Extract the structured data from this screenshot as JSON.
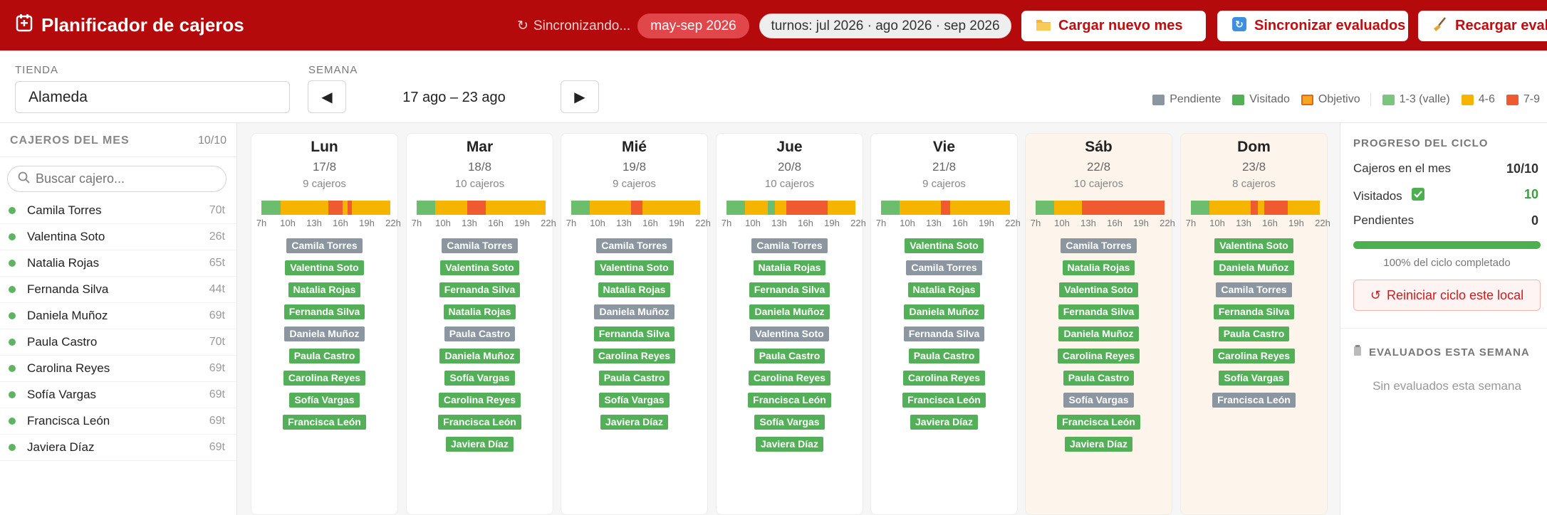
{
  "app": {
    "title": "Planificador de cajeros"
  },
  "header": {
    "sync_status": "Sincronizando...",
    "range_pill": "may-sep 2026",
    "turnos_pill": "turnos: jul 2026 · ago 2026 · sep 2026",
    "btn_cargar": "Cargar nuevo mes",
    "btn_sync": "Sincronizar evaluados",
    "btn_recargar": "Recargar evaluados"
  },
  "toolbar": {
    "tienda_label": "TIENDA",
    "tienda_value": "Alameda",
    "semana_label": "SEMANA",
    "week_range": "17 ago – 23 ago",
    "prev_symbol": "◀",
    "next_symbol": "▶"
  },
  "legend": [
    {
      "label": "Pendiente",
      "color": "#8b96a0"
    },
    {
      "label": "Visitado",
      "color": "#54b058"
    },
    {
      "label": "Objetivo",
      "color": "#f5a623"
    },
    {
      "label": "1-3 (valle)",
      "color": "#7cc57f"
    },
    {
      "label": "4-6",
      "color": "#f4b400"
    },
    {
      "label": "7-9",
      "color": "#f05a30"
    }
  ],
  "sidebar": {
    "title": "CAJEROS DEL MES",
    "count": "10/10",
    "search_placeholder": "Buscar cajero...",
    "cashiers": [
      {
        "name": "Camila Torres",
        "turns": "70t"
      },
      {
        "name": "Valentina Soto",
        "turns": "26t"
      },
      {
        "name": "Natalia Rojas",
        "turns": "65t"
      },
      {
        "name": "Fernanda Silva",
        "turns": "44t"
      },
      {
        "name": "Daniela Muñoz",
        "turns": "69t"
      },
      {
        "name": "Paula Castro",
        "turns": "70t"
      },
      {
        "name": "Carolina Reyes",
        "turns": "69t"
      },
      {
        "name": "Sofía Vargas",
        "turns": "69t"
      },
      {
        "name": "Francisca León",
        "turns": "69t"
      },
      {
        "name": "Javiera Díaz",
        "turns": "69t"
      }
    ]
  },
  "tick_labels": [
    "7h",
    "10h",
    "13h",
    "16h",
    "19h",
    "22h"
  ],
  "intensity_colors": {
    "g": "#6cbd6e",
    "y": "#f4b400",
    "r": "#f05a30"
  },
  "days": [
    {
      "name": "Lun",
      "date": "17/8",
      "count": "9 cajeros",
      "weekend": false,
      "bar": [
        [
          "g",
          2
        ],
        [
          "y",
          5
        ],
        [
          "r",
          1.5
        ],
        [
          "y",
          0.5
        ],
        [
          "r",
          0.5
        ],
        [
          "y",
          4
        ]
      ],
      "chips": [
        [
          "Camila Torres",
          "p"
        ],
        [
          "Valentina Soto",
          "v"
        ],
        [
          "Natalia Rojas",
          "v"
        ],
        [
          "Fernanda Silva",
          "v"
        ],
        [
          "Daniela Muñoz",
          "p"
        ],
        [
          "Paula Castro",
          "v"
        ],
        [
          "Carolina Reyes",
          "v"
        ],
        [
          "Sofía Vargas",
          "v"
        ],
        [
          "Francisca León",
          "v"
        ]
      ]
    },
    {
      "name": "Mar",
      "date": "18/8",
      "count": "10 cajeros",
      "weekend": false,
      "bar": [
        [
          "g",
          2
        ],
        [
          "y",
          3.5
        ],
        [
          "r",
          2
        ],
        [
          "y",
          6.5
        ]
      ],
      "chips": [
        [
          "Camila Torres",
          "p"
        ],
        [
          "Valentina Soto",
          "v"
        ],
        [
          "Fernanda Silva",
          "v"
        ],
        [
          "Natalia Rojas",
          "v"
        ],
        [
          "Paula Castro",
          "p"
        ],
        [
          "Daniela Muñoz",
          "v"
        ],
        [
          "Sofía Vargas",
          "v"
        ],
        [
          "Carolina Reyes",
          "v"
        ],
        [
          "Francisca León",
          "v"
        ],
        [
          "Javiera Díaz",
          "v"
        ]
      ]
    },
    {
      "name": "Mié",
      "date": "19/8",
      "count": "9 cajeros",
      "weekend": false,
      "bar": [
        [
          "g",
          2
        ],
        [
          "y",
          4.5
        ],
        [
          "r",
          1.2
        ],
        [
          "y",
          6.3
        ]
      ],
      "chips": [
        [
          "Camila Torres",
          "p"
        ],
        [
          "Valentina Soto",
          "v"
        ],
        [
          "Natalia Rojas",
          "v"
        ],
        [
          "Daniela Muñoz",
          "p"
        ],
        [
          "Fernanda Silva",
          "v"
        ],
        [
          "Carolina Reyes",
          "v"
        ],
        [
          "Paula Castro",
          "v"
        ],
        [
          "Sofía Vargas",
          "v"
        ],
        [
          "Javiera Díaz",
          "v"
        ]
      ]
    },
    {
      "name": "Jue",
      "date": "20/8",
      "count": "10 cajeros",
      "weekend": false,
      "bar": [
        [
          "g",
          2
        ],
        [
          "y",
          2.5
        ],
        [
          "g",
          0.8
        ],
        [
          "y",
          1.2
        ],
        [
          "r",
          4.5
        ],
        [
          "y",
          3
        ]
      ],
      "chips": [
        [
          "Camila Torres",
          "p"
        ],
        [
          "Natalia Rojas",
          "v"
        ],
        [
          "Fernanda Silva",
          "v"
        ],
        [
          "Daniela Muñoz",
          "v"
        ],
        [
          "Valentina Soto",
          "p"
        ],
        [
          "Paula Castro",
          "v"
        ],
        [
          "Carolina Reyes",
          "v"
        ],
        [
          "Francisca León",
          "v"
        ],
        [
          "Sofía Vargas",
          "v"
        ],
        [
          "Javiera Díaz",
          "v"
        ]
      ]
    },
    {
      "name": "Vie",
      "date": "21/8",
      "count": "9 cajeros",
      "weekend": false,
      "bar": [
        [
          "g",
          2
        ],
        [
          "y",
          4.5
        ],
        [
          "r",
          1
        ],
        [
          "y",
          6.5
        ]
      ],
      "chips": [
        [
          "Valentina Soto",
          "v"
        ],
        [
          "Camila Torres",
          "p"
        ],
        [
          "Natalia Rojas",
          "v"
        ],
        [
          "Daniela Muñoz",
          "v"
        ],
        [
          "Fernanda Silva",
          "p"
        ],
        [
          "Paula Castro",
          "v"
        ],
        [
          "Carolina Reyes",
          "v"
        ],
        [
          "Francisca León",
          "v"
        ],
        [
          "Javiera Díaz",
          "v"
        ]
      ]
    },
    {
      "name": "Sáb",
      "date": "22/8",
      "count": "10 cajeros",
      "weekend": true,
      "bar": [
        [
          "g",
          2
        ],
        [
          "y",
          3
        ],
        [
          "r",
          9
        ]
      ],
      "chips": [
        [
          "Camila Torres",
          "p"
        ],
        [
          "Natalia Rojas",
          "v"
        ],
        [
          "Valentina Soto",
          "v"
        ],
        [
          "Fernanda Silva",
          "v"
        ],
        [
          "Daniela Muñoz",
          "v"
        ],
        [
          "Carolina Reyes",
          "v"
        ],
        [
          "Paula Castro",
          "v"
        ],
        [
          "Sofía Vargas",
          "p"
        ],
        [
          "Francisca León",
          "v"
        ],
        [
          "Javiera Díaz",
          "v"
        ]
      ]
    },
    {
      "name": "Dom",
      "date": "23/8",
      "count": "8 cajeros",
      "weekend": true,
      "bar": [
        [
          "g",
          2
        ],
        [
          "y",
          4.5
        ],
        [
          "r",
          0.8
        ],
        [
          "y",
          0.7
        ],
        [
          "r",
          2.5
        ],
        [
          "y",
          3.5
        ]
      ],
      "chips": [
        [
          "Valentina Soto",
          "v"
        ],
        [
          "Daniela Muñoz",
          "v"
        ],
        [
          "Camila Torres",
          "p"
        ],
        [
          "Fernanda Silva",
          "v"
        ],
        [
          "Paula Castro",
          "v"
        ],
        [
          "Carolina Reyes",
          "v"
        ],
        [
          "Sofía Vargas",
          "v"
        ],
        [
          "Francisca León",
          "p"
        ]
      ]
    }
  ],
  "progress": {
    "title": "PROGRESO DEL CICLO",
    "cajeros_label": "Cajeros en el mes",
    "cajeros_value": "10/10",
    "visitados_label": "Visitados",
    "visitados_value": "10",
    "pendientes_label": "Pendientes",
    "pendientes_value": "0",
    "fraction": 1.0,
    "completed_text": "100% del ciclo completado",
    "reset_label": "Reiniciar ciclo este local"
  },
  "evaluados": {
    "title": "EVALUADOS ESTA SEMANA",
    "empty": "Sin evaluados esta semana"
  }
}
